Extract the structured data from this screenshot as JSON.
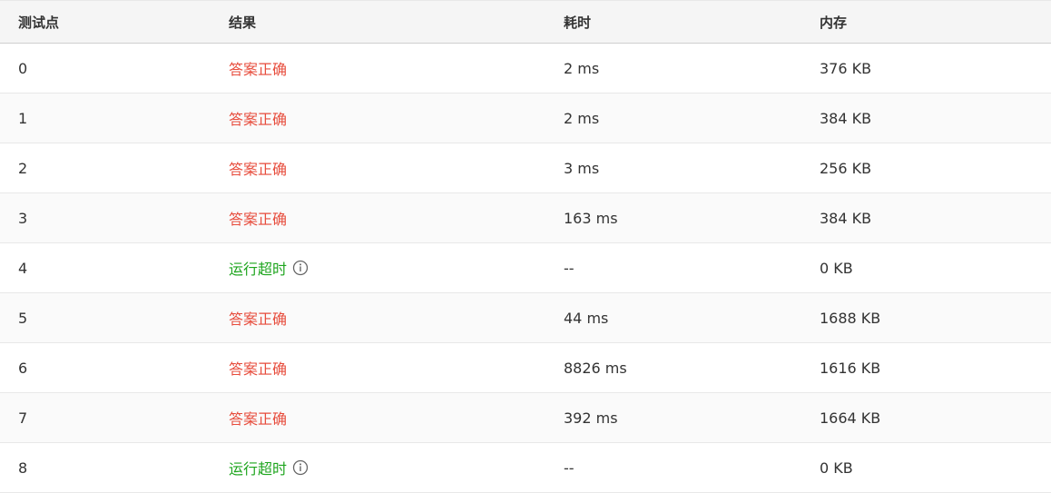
{
  "headers": {
    "case": "测试点",
    "result": "结果",
    "time": "耗时",
    "memory": "内存"
  },
  "colors": {
    "accepted": "#e74c3c",
    "time_limit": "#1ea51e"
  },
  "rows": [
    {
      "case": "0",
      "result": "答案正确",
      "status": "accepted",
      "time": "2 ms",
      "memory": "376 KB"
    },
    {
      "case": "1",
      "result": "答案正确",
      "status": "accepted",
      "time": "2 ms",
      "memory": "384 KB"
    },
    {
      "case": "2",
      "result": "答案正确",
      "status": "accepted",
      "time": "3 ms",
      "memory": "256 KB"
    },
    {
      "case": "3",
      "result": "答案正确",
      "status": "accepted",
      "time": "163 ms",
      "memory": "384 KB"
    },
    {
      "case": "4",
      "result": "运行超时",
      "status": "time_limit",
      "info_icon": "info-circle-icon",
      "time": "--",
      "memory": "0 KB"
    },
    {
      "case": "5",
      "result": "答案正确",
      "status": "accepted",
      "time": "44 ms",
      "memory": "1688 KB"
    },
    {
      "case": "6",
      "result": "答案正确",
      "status": "accepted",
      "time": "8826 ms",
      "memory": "1616 KB"
    },
    {
      "case": "7",
      "result": "答案正确",
      "status": "accepted",
      "time": "392 ms",
      "memory": "1664 KB"
    },
    {
      "case": "8",
      "result": "运行超时",
      "status": "time_limit",
      "info_icon": "info-circle-icon",
      "time": "--",
      "memory": "0 KB"
    }
  ]
}
